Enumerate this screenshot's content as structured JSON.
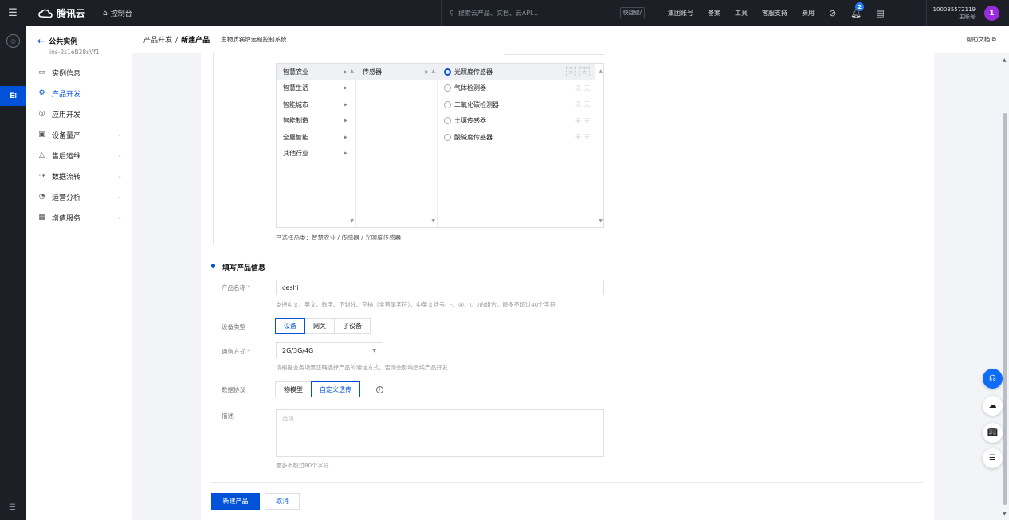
{
  "topbar": {
    "brand": "腾讯云",
    "console": "控制台",
    "search_placeholder": "搜索云产品、文档、云API...",
    "shortcut": "快捷键/",
    "links": [
      "集团账号",
      "备案",
      "工具",
      "客服支持",
      "费用"
    ],
    "notification_count": "2",
    "account_id": "100035572119",
    "account_role": "主账号",
    "avatar_letter": "1"
  },
  "sidebar": {
    "title": "公共实例",
    "instance_id": "ins-2s1eB28sVf1",
    "items": [
      {
        "label": "实例信息",
        "icon": "monitor-icon"
      },
      {
        "label": "产品开发",
        "icon": "gear-icon"
      },
      {
        "label": "应用开发",
        "icon": "app-icon"
      },
      {
        "label": "设备量产",
        "icon": "chip-icon"
      },
      {
        "label": "售后运维",
        "icon": "warning-icon"
      },
      {
        "label": "数据流转",
        "icon": "flow-icon"
      },
      {
        "label": "运营分析",
        "icon": "chart-icon"
      },
      {
        "label": "增值服务",
        "icon": "service-icon"
      }
    ]
  },
  "header": {
    "crumb_parent": "产品开发",
    "crumb_current": "新建产品",
    "system_name": "生物质锅炉远程控制系统",
    "help": "帮助文档"
  },
  "cascader": {
    "level1": [
      "智慧农业",
      "智慧生活",
      "智能城市",
      "智能制造",
      "全屋智能",
      "其他行业"
    ],
    "level2": [
      "传感器"
    ],
    "level3": [
      "光照度传感器",
      "气体检测器",
      "二氧化碳检测器",
      "土壤传感器",
      "酸碱度传感器"
    ],
    "tag_a": "无",
    "tag_b": "无",
    "selected_text": "已选择品类：智慧农业 / 传感器 / 光照度传感器"
  },
  "form": {
    "section_title": "填写产品信息",
    "name_label": "产品名称",
    "name_value": "ceshi",
    "name_hint": "支持中文、英文、数字、下划线、空格（非首尾字符）、中英文括号、-、@、\\、/的组合，最多不超过40个字符",
    "device_type_label": "设备类型",
    "device_types": [
      "设备",
      "网关",
      "子设备"
    ],
    "comm_label": "通信方式",
    "comm_value": "2G/3G/4G",
    "comm_hint": "请根据业务场景正确选择产品的通信方式，否则会影响后续产品开发",
    "protocol_label": "数据协议",
    "protocols": [
      "物模型",
      "自定义透传"
    ],
    "desc_label": "描述",
    "desc_placeholder": "选填",
    "desc_hint": "最多不超过80个字符",
    "submit": "新建产品",
    "cancel": "取消"
  }
}
